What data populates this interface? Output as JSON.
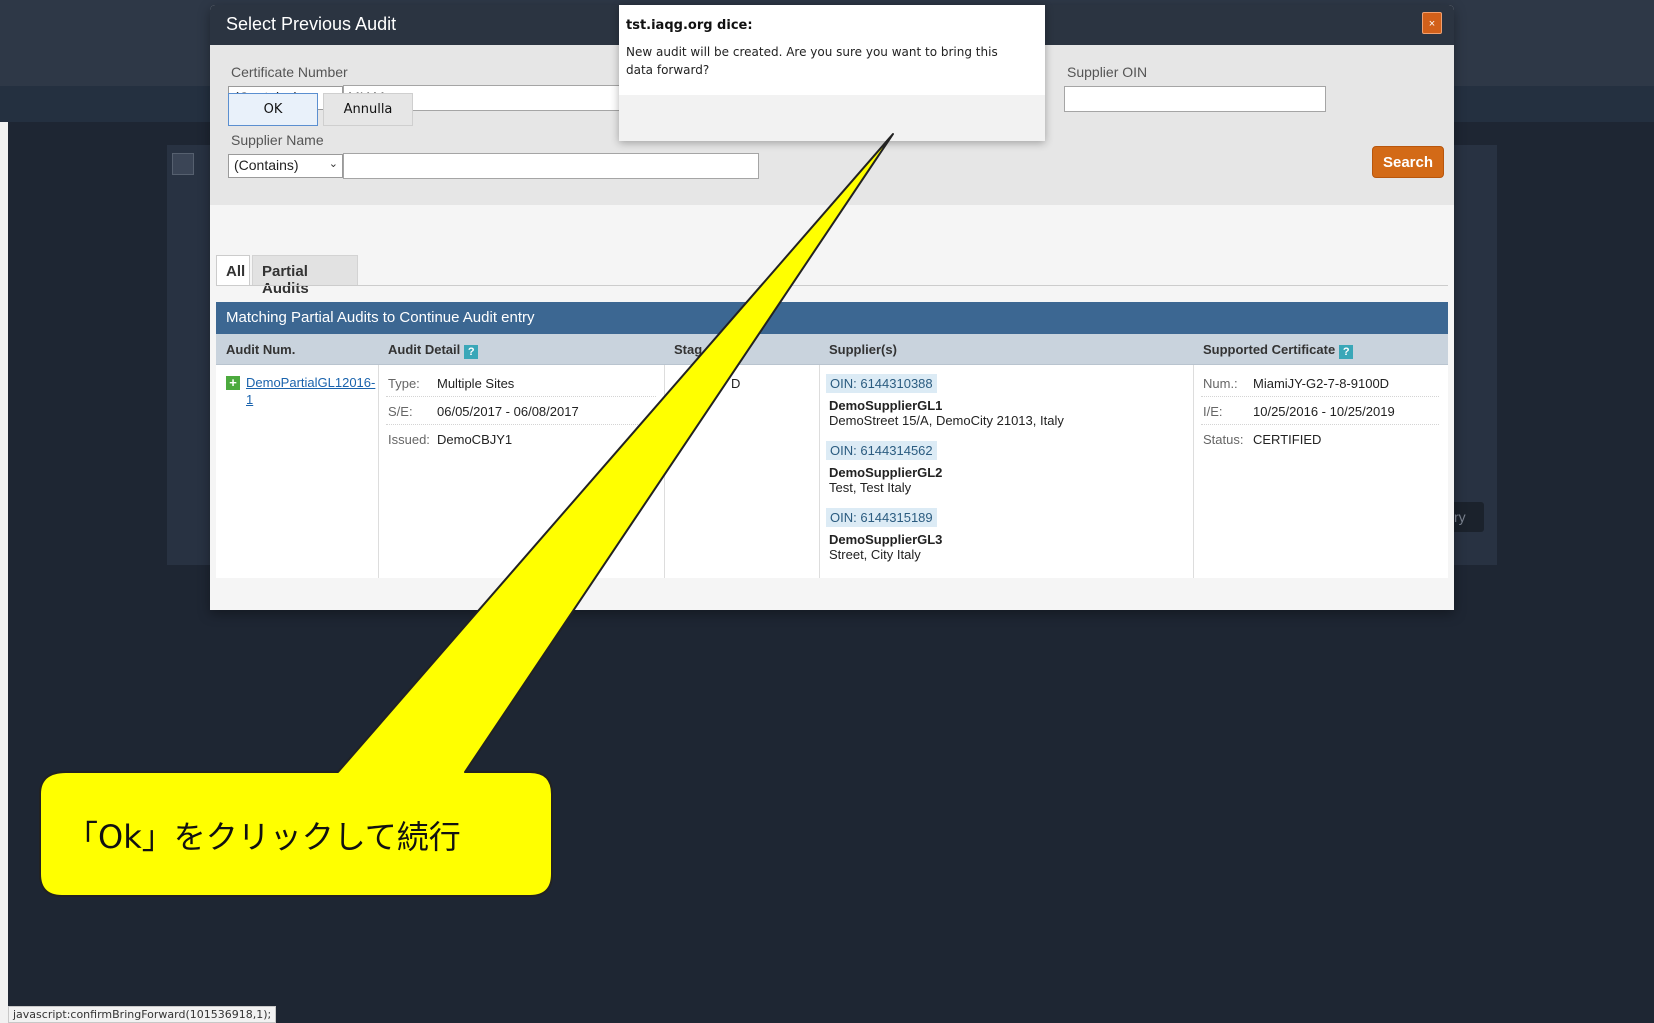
{
  "modal": {
    "title": "Select Previous Audit",
    "close_label": "×",
    "filters": {
      "certificate_number_label": "Certificate Number",
      "certificate_number_operator": "(Contains)",
      "certificate_number_value": "MIAM",
      "supplier_oin_label": "Supplier OIN",
      "supplier_oin_value": "",
      "supplier_name_label": "Supplier Name",
      "supplier_name_operator": "(Contains)",
      "supplier_name_value": "",
      "search_label": "Search"
    },
    "tabs": [
      {
        "label": "All",
        "active": true
      },
      {
        "label": "Partial Audits",
        "active": false
      }
    ],
    "grid": {
      "caption": "Matching Partial Audits to Continue Audit entry",
      "columns": [
        "Audit Num.",
        "Audit Detail",
        "Stag",
        "Supplier(s)",
        "Supported Certificate"
      ],
      "row": {
        "audit_num_line1": "DemoPartialGL12016-",
        "audit_num_line2": "1",
        "type_label": "Type:",
        "type_value": "Multiple Sites",
        "se_label": "S/E:",
        "se_value": "06/05/2017 - 06/08/2017",
        "issued_label": "Issued:",
        "issued_value": "DemoCBJY1",
        "stage_fragment": "D",
        "suppliers": [
          {
            "oin": "OIN: 6144310388",
            "name": "DemoSupplierGL1",
            "address": "DemoStreet 15/A, DemoCity 21013, Italy"
          },
          {
            "oin": "OIN: 6144314562",
            "name": "DemoSupplierGL2",
            "address": "Test, Test Italy"
          },
          {
            "oin": "OIN: 6144315189",
            "name": "DemoSupplierGL3",
            "address": "Street, City Italy"
          }
        ],
        "num_label": "Num.:",
        "num_value": "MiamiJY-G2-7-8-9100D",
        "ie_label": "I/E:",
        "ie_value": "10/25/2016 - 10/25/2019",
        "status_label": "Status:",
        "status_value": "CERTIFIED"
      }
    }
  },
  "confirm_dialog": {
    "title": "tst.iaqg.org dice:",
    "message": "New audit will be created. Are you sure you want to bring this data forward?",
    "ok_label": "OK",
    "cancel_label": "Annulla"
  },
  "callout": {
    "text": "「Ok」をクリックして続行",
    "fill_color": "#ffff00"
  },
  "background_button_fragment": "ry",
  "status_bar": "javascript:confirmBringForward(101536918,1);"
}
